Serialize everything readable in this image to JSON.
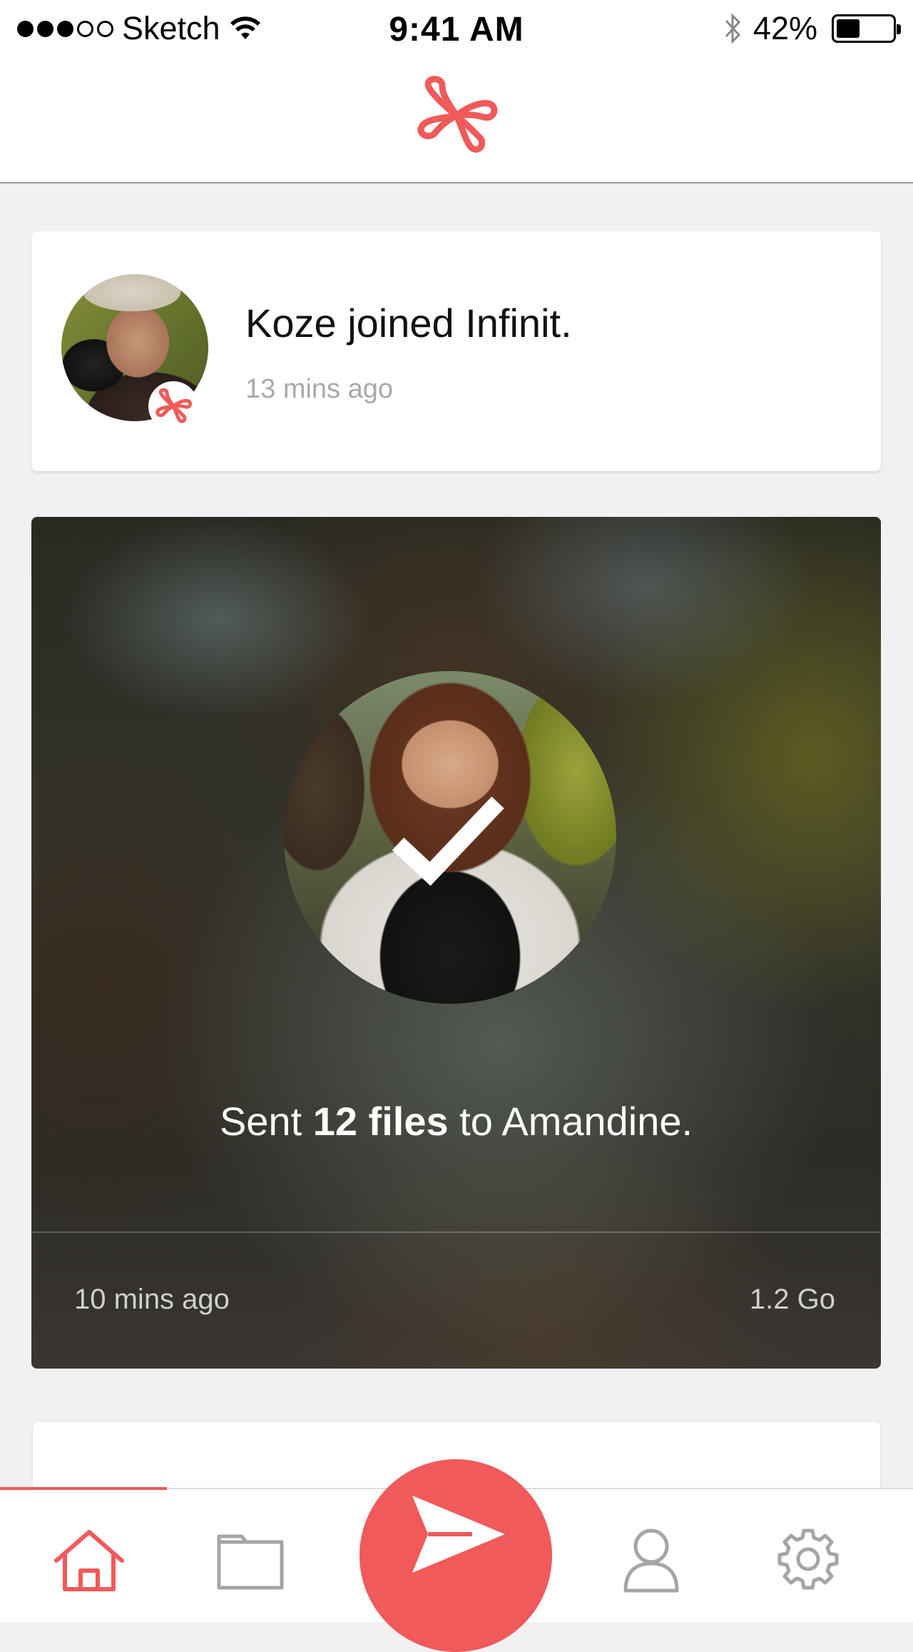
{
  "status_bar": {
    "carrier": "Sketch",
    "time": "9:41 AM",
    "battery_percent": "42%",
    "battery_level": 0.42,
    "signal_bars_filled": 3,
    "signal_bars_total": 5
  },
  "header": {
    "logo_icon": "infinit-logo-icon"
  },
  "feed": {
    "item1": {
      "title": "Koze joined Infinit.",
      "time": "13 mins ago"
    },
    "item2": {
      "message_prefix": "Sent ",
      "message_bold": "12 files",
      "message_suffix": " to Amandine.",
      "time": "10 mins ago",
      "size": "1.2 Go",
      "status_icon": "checkmark-icon"
    }
  },
  "tab_bar": {
    "tabs": [
      "home",
      "files",
      "send",
      "profile",
      "settings"
    ],
    "active_tab": "home"
  },
  "colors": {
    "accent": "#f05a5a"
  }
}
